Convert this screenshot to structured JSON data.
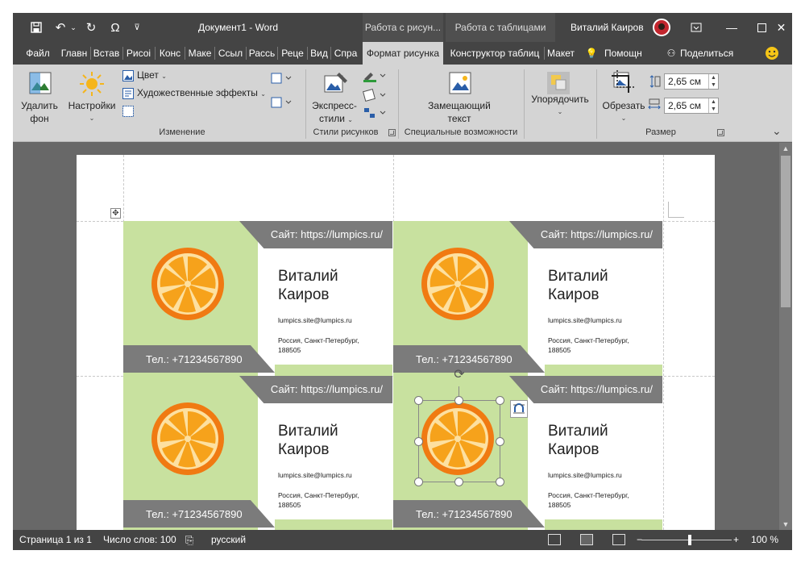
{
  "title_bar": {
    "document_title": "Документ1  -  Word",
    "context_tab_picture": "Работа с рисун...",
    "context_tab_tables": "Работа с таблицами",
    "user_name": "Виталий Каиров",
    "qat_icons": [
      "save-icon",
      "undo-icon",
      "redo-icon",
      "omega-icon",
      "customize-icon"
    ],
    "window_controls": [
      "ribbon-display-icon",
      "minimize-icon",
      "maximize-icon",
      "close-icon"
    ]
  },
  "ribbon_tabs": [
    "Файл",
    "Главн",
    "Встав",
    "Рисоі",
    "Конс",
    "Маке",
    "Ссыл",
    "Рассь",
    "Реце",
    "Вид",
    "Спра",
    "Формат рисунка",
    "Конструктор таблиц",
    "Макет"
  ],
  "ribbon_extra": {
    "tell_me": "Помощн",
    "share": "Поделиться"
  },
  "ribbon": {
    "remove_bg_line1": "Удалить",
    "remove_bg_line2": "фон",
    "corrections": "Настройки",
    "color": "Цвет",
    "artistic_effects": "Художественные эффекты",
    "quick_styles_line1": "Экспресс-",
    "quick_styles_line2": "стили",
    "alt_text_line1": "Замещающий",
    "alt_text_line2": "текст",
    "arrange": "Упорядочить",
    "crop": "Обрезать",
    "height": "2,65 см",
    "width": "2,65 см",
    "groups": {
      "adjust": "Изменение",
      "picture_styles": "Стили рисунков",
      "accessibility": "Специальные возможности",
      "size": "Размер"
    }
  },
  "cards": [
    {
      "site": "Сайт: https://lumpics.ru/",
      "name_line1": "Виталий",
      "name_line2": "Каиров",
      "email": "lumpics.site@lumpics.ru",
      "address_line1": "Россия, Санкт-Петербург,",
      "address_line2": "188505",
      "phone": "Тел.: +71234567890"
    },
    {
      "site": "Сайт: https://lumpics.ru/",
      "name_line1": "Виталий",
      "name_line2": "Каиров",
      "email": "lumpics.site@lumpics.ru",
      "address_line1": "Россия, Санкт-Петербург,",
      "address_line2": "188505",
      "phone": "Тел.: +71234567890"
    },
    {
      "site": "Сайт: https://lumpics.ru/",
      "name_line1": "Виталий",
      "name_line2": "Каиров",
      "email": "lumpics.site@lumpics.ru",
      "address_line1": "Россия, Санкт-Петербург,",
      "address_line2": "188505",
      "phone": "Тел.: +71234567890"
    },
    {
      "site": "Сайт: https://lumpics.ru/",
      "name_line1": "Виталий",
      "name_line2": "Каиров",
      "email": "lumpics.site@lumpics.ru",
      "address_line1": "Россия, Санкт-Петербург,",
      "address_line2": "188505",
      "phone": "Тел.: +71234567890"
    }
  ],
  "status_bar": {
    "page": "Страница 1 из 1",
    "words": "Число слов: 100",
    "language": "русский",
    "zoom": "100 %",
    "zoom_minus": "−",
    "zoom_plus": "+"
  },
  "colors": {
    "card_green": "#c8e19f",
    "card_gray": "#7b7b7b",
    "orange_rind": "#f07a12",
    "orange_flesh": "#f6a21b",
    "ribbon_bg": "#d4d4d4",
    "title_bg": "#444444"
  }
}
